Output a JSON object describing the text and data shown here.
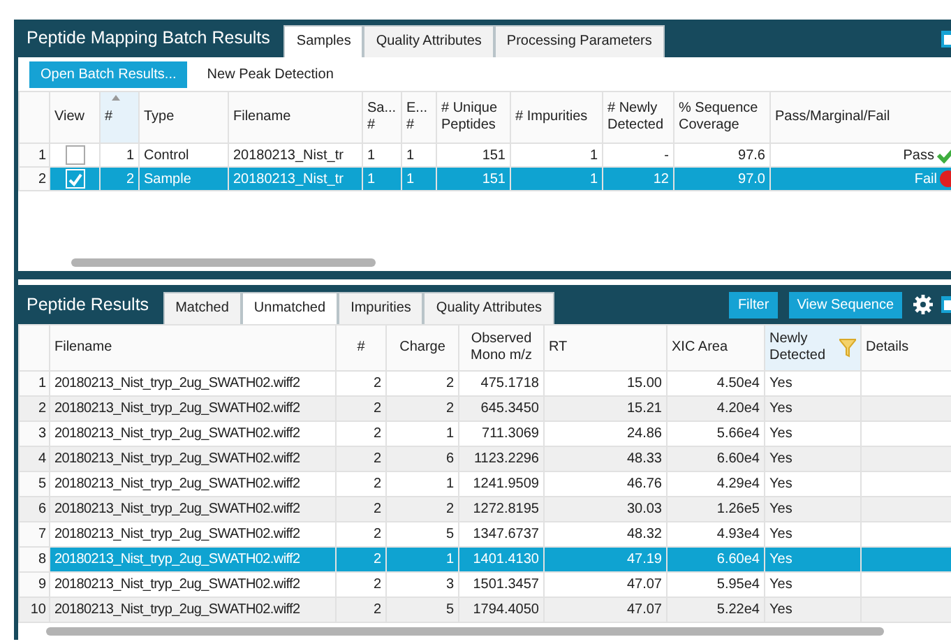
{
  "batch_panel": {
    "title": "Peptide Mapping Batch Results",
    "tabs": [
      {
        "label": "Samples",
        "selected": true
      },
      {
        "label": "Quality Attributes",
        "selected": false
      },
      {
        "label": "Processing Parameters",
        "selected": false
      }
    ],
    "toolbar": [
      {
        "label": "Open Batch Results...",
        "kind": "primary"
      },
      {
        "label": "New Peak Detection",
        "kind": "plain"
      }
    ],
    "table": {
      "columns": [
        "View",
        "#",
        "Type",
        "Filename",
        "Sa... #",
        "E... #",
        "# Unique Peptides",
        "# Impurities",
        "# Newly Detected",
        "% Sequence Coverage",
        "Pass/Marginal/Fail"
      ],
      "rows": [
        {
          "row_header": "1",
          "view_checked": false,
          "selected": false,
          "cells": [
            "",
            "1",
            "Control",
            "20180213_Nist_tr",
            "1",
            "1",
            "151",
            "1",
            "-",
            "97.6",
            "Pass"
          ],
          "kind": "pass"
        },
        {
          "row_header": "2",
          "view_checked": true,
          "selected": true,
          "cells": [
            "",
            "2",
            "Sample",
            "20180213_Nist_tr",
            "1",
            "1",
            "151",
            "1",
            "12",
            "97.0",
            "Fail"
          ],
          "kind": "fail"
        }
      ]
    }
  },
  "results_panel": {
    "title": "Peptide Results",
    "tabs": [
      {
        "label": "Matched",
        "selected": false
      },
      {
        "label": "Unmatched",
        "selected": true
      },
      {
        "label": "Impurities",
        "selected": false
      },
      {
        "label": "Quality Attributes",
        "selected": false
      }
    ],
    "buttons": [
      "Filter",
      "View Sequence"
    ],
    "table": {
      "columns": [
        "Filename",
        "#",
        "Charge",
        "Observed Mono m/z",
        "RT",
        "XIC Area",
        "Newly Detected",
        "Details"
      ],
      "rows": [
        {
          "row_header": "1",
          "selected": false,
          "cells": [
            "20180213_Nist_tryp_2ug_SWATH02.wiff2",
            "2",
            "2",
            "475.1718",
            "15.00",
            "4.50e4",
            "Yes",
            ""
          ]
        },
        {
          "row_header": "2",
          "selected": false,
          "cells": [
            "20180213_Nist_tryp_2ug_SWATH02.wiff2",
            "2",
            "2",
            "645.3450",
            "15.21",
            "4.20e4",
            "Yes",
            ""
          ]
        },
        {
          "row_header": "3",
          "selected": false,
          "cells": [
            "20180213_Nist_tryp_2ug_SWATH02.wiff2",
            "2",
            "1",
            "711.3069",
            "24.86",
            "5.66e4",
            "Yes",
            ""
          ]
        },
        {
          "row_header": "4",
          "selected": false,
          "cells": [
            "20180213_Nist_tryp_2ug_SWATH02.wiff2",
            "2",
            "6",
            "1123.2296",
            "48.33",
            "6.60e4",
            "Yes",
            ""
          ]
        },
        {
          "row_header": "5",
          "selected": false,
          "cells": [
            "20180213_Nist_tryp_2ug_SWATH02.wiff2",
            "2",
            "1",
            "1241.9509",
            "46.76",
            "4.29e4",
            "Yes",
            ""
          ]
        },
        {
          "row_header": "6",
          "selected": false,
          "cells": [
            "20180213_Nist_tryp_2ug_SWATH02.wiff2",
            "2",
            "2",
            "1272.8195",
            "30.03",
            "1.26e5",
            "Yes",
            ""
          ]
        },
        {
          "row_header": "7",
          "selected": false,
          "cells": [
            "20180213_Nist_tryp_2ug_SWATH02.wiff2",
            "2",
            "5",
            "1347.6737",
            "48.32",
            "4.93e4",
            "Yes",
            ""
          ]
        },
        {
          "row_header": "8",
          "selected": true,
          "cells": [
            "20180213_Nist_tryp_2ug_SWATH02.wiff2",
            "2",
            "1",
            "1401.4130",
            "47.19",
            "6.60e4",
            "Yes",
            ""
          ]
        },
        {
          "row_header": "9",
          "selected": false,
          "cells": [
            "20180213_Nist_tryp_2ug_SWATH02.wiff2",
            "2",
            "3",
            "1501.3457",
            "47.07",
            "5.95e4",
            "Yes",
            ""
          ]
        },
        {
          "row_header": "10",
          "selected": false,
          "cells": [
            "20180213_Nist_tryp_2ug_SWATH02.wiff2",
            "2",
            "5",
            "1794.4050",
            "47.07",
            "5.22e4",
            "Yes",
            ""
          ]
        }
      ]
    }
  }
}
